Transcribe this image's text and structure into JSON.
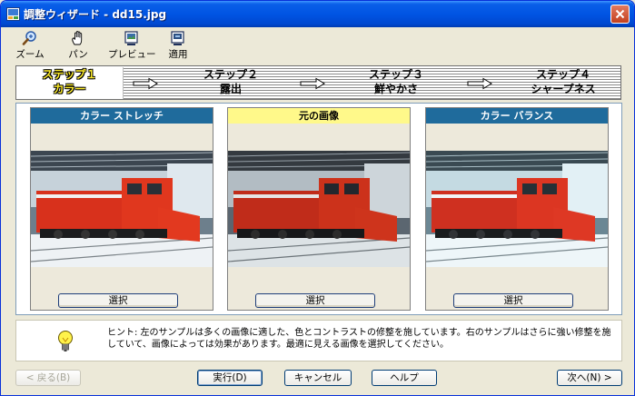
{
  "window": {
    "title": "調整ウィザード - dd15.jpg"
  },
  "toolbar": {
    "items": [
      {
        "label": "ズーム",
        "icon": "zoom-icon"
      },
      {
        "label": "パン",
        "icon": "pan-hand-icon"
      },
      {
        "label": "プレビュー",
        "icon": "preview-icon"
      },
      {
        "label": "適用",
        "icon": "apply-icon"
      }
    ]
  },
  "steps": [
    {
      "line1": "ステップ１",
      "line2": "カラー",
      "active": true
    },
    {
      "line1": "ステップ２",
      "line2": "露出",
      "active": false
    },
    {
      "line1": "ステップ３",
      "line2": "鮮やかさ",
      "active": false
    },
    {
      "line1": "ステップ４",
      "line2": "シャープネス",
      "active": false
    }
  ],
  "cards": [
    {
      "header": "カラー ストレッチ",
      "button": "選択",
      "tone": "stretch"
    },
    {
      "header": "元の画像",
      "button": "選択",
      "tone": "original"
    },
    {
      "header": "カラー バランス",
      "button": "選択",
      "tone": "balance"
    }
  ],
  "hint": {
    "text": "ヒント: 左のサンプルは多くの画像に適した、色とコントラストの修整を施しています。右のサンプルはさらに強い修整を施していて、画像によっては効果があります。最適に見える画像を選択してください。"
  },
  "buttons": {
    "back": "< 戻る(B)",
    "run": "実行(D)",
    "cancel": "キャンセル",
    "help": "ヘルプ",
    "next": "次へ(N) >"
  },
  "colors": {
    "titlebar": "#0054e3",
    "card_header": "#1f6b9c",
    "original_header": "#fff98a",
    "active_step_text": "#fdec2a"
  }
}
